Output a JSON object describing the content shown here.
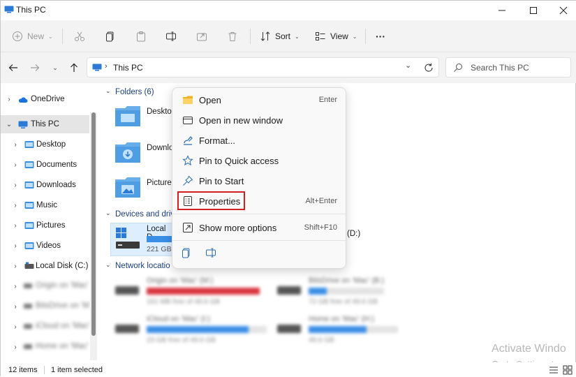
{
  "window": {
    "title": "This PC",
    "controls": [
      "minimize",
      "maximize",
      "close"
    ]
  },
  "toolbar": {
    "new_label": "New",
    "sort_label": "Sort",
    "view_label": "View",
    "more_label": "···"
  },
  "address": {
    "path": "This PC",
    "search_placeholder": "Search This PC"
  },
  "nav": {
    "items": [
      {
        "label": "OneDrive"
      },
      {
        "label": "This PC"
      },
      {
        "label": "Desktop"
      },
      {
        "label": "Documents"
      },
      {
        "label": "Downloads"
      },
      {
        "label": "Music"
      },
      {
        "label": "Pictures"
      },
      {
        "label": "Videos"
      },
      {
        "label": "Local Disk (C:)"
      },
      {
        "label": "Origin on 'Mac'"
      },
      {
        "label": "BitsDrive on 'M"
      },
      {
        "label": "iCloud on 'Mac'"
      },
      {
        "label": "Home on 'Mac'"
      }
    ]
  },
  "content": {
    "folders_header": "Folders (6)",
    "devices_header": "Devices and driv",
    "network_header": "Network locatio",
    "folders": [
      {
        "label": "Deskto"
      },
      {
        "label": "Downlo"
      },
      {
        "label": "Picture"
      }
    ],
    "drive": {
      "name": "Local D",
      "size": "221 GB",
      "second_drive": "(D:)"
    },
    "network": [
      {
        "name": "Origin on 'Mac' (M:)",
        "free": "161 MB free of 49.6 GB",
        "fill": 1.0,
        "color": "#d9363e"
      },
      {
        "name": "BitsDrive on 'Mac' (B:)",
        "free": "72 GB free of 49.6 GB",
        "fill": 0.18,
        "color": "#3a8ee6"
      },
      {
        "name": "iCloud on 'Mac' (I:)",
        "free": "23 GB free of 49.6 GB",
        "fill": 0.85,
        "color": "#3a8ee6"
      },
      {
        "name": "Home on 'Mac' (H:)",
        "free": "49.6 GB",
        "fill": 0.65,
        "color": "#3a8ee6"
      }
    ]
  },
  "context_menu": {
    "items": [
      {
        "label": "Open",
        "shortcut": "Enter"
      },
      {
        "label": "Open in new window",
        "shortcut": ""
      },
      {
        "label": "Format...",
        "shortcut": ""
      },
      {
        "label": "Pin to Quick access",
        "shortcut": ""
      },
      {
        "label": "Pin to Start",
        "shortcut": ""
      },
      {
        "label": "Properties",
        "shortcut": "Alt+Enter"
      },
      {
        "label": "Show more options",
        "shortcut": "Shift+F10"
      }
    ],
    "highlight_color": "#d31f1f"
  },
  "status": {
    "items_count": "12 items",
    "selection": "1 item selected"
  },
  "watermark": {
    "line1": "Activate Windo",
    "line2": "Go to Settings to"
  }
}
